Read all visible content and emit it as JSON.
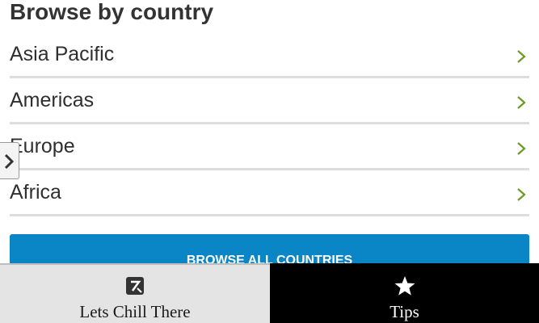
{
  "section": {
    "title": "Browse by country"
  },
  "regions": [
    {
      "label": "Asia Pacific"
    },
    {
      "label": "Americas"
    },
    {
      "label": "Europe"
    },
    {
      "label": "Africa"
    }
  ],
  "browse_all_label": "BROWSE ALL COUNTRIES",
  "bottom_nav": {
    "tabs": [
      {
        "label": "Lets Chill There",
        "icon": "app-logo-icon"
      },
      {
        "label": "Tips",
        "icon": "star-icon"
      }
    ]
  },
  "colors": {
    "accent_blue": "#0a85c6",
    "chevron_green": "#6a9a1f",
    "title_text": "#333333",
    "divider": "#dddddd"
  }
}
